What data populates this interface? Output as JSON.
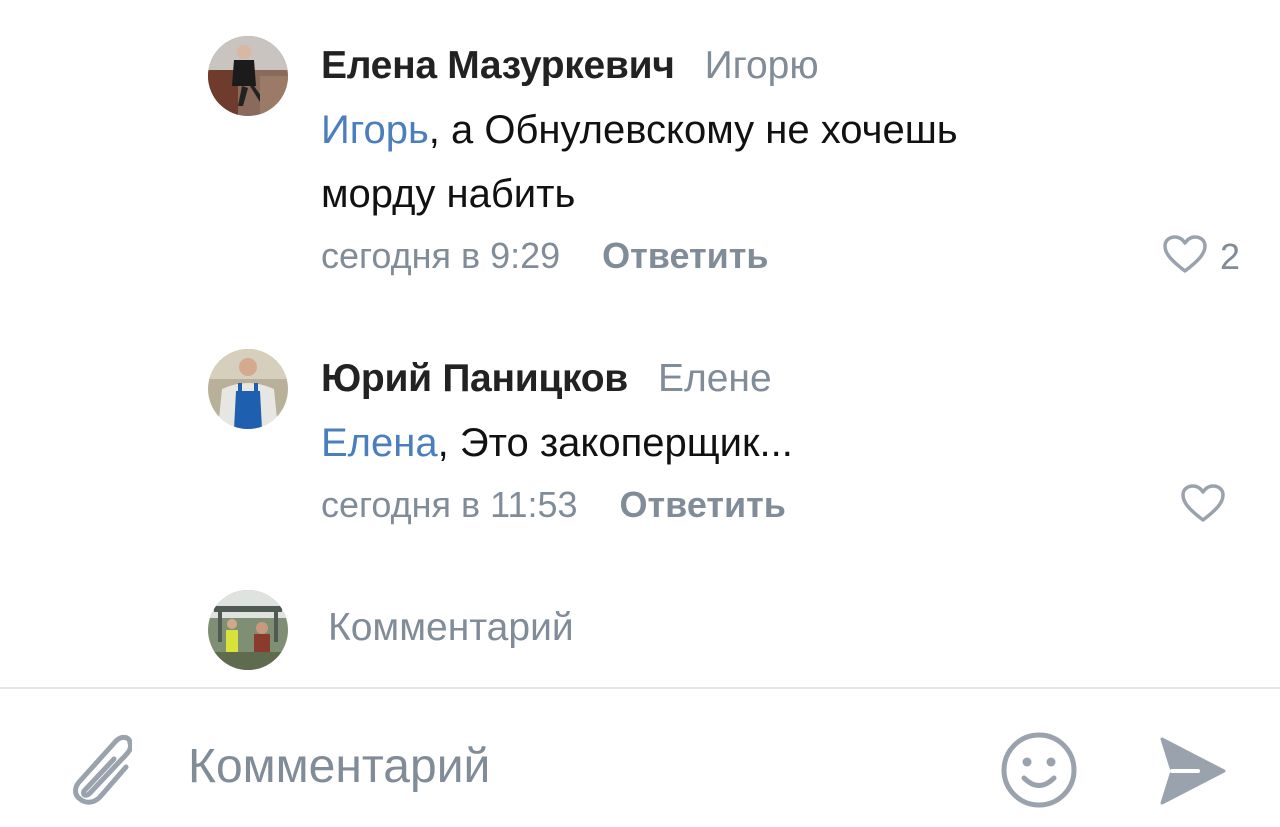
{
  "comments": [
    {
      "author": "Елена Мазуркевич",
      "reply_to": "Игорю",
      "mention": "Игорь",
      "text_line1_rest": ", а Обнулевскому не хочешь",
      "text_line2": "морду набить",
      "time": "сегодня в 9:29",
      "reply_label": "Ответить",
      "likes": "2"
    },
    {
      "author": "Юрий Паницков",
      "reply_to": "Елене",
      "mention": "Елена",
      "text_line1_rest": ", Это закоперщик...",
      "time": "сегодня в 11:53",
      "reply_label": "Ответить"
    }
  ],
  "reply_row": {
    "placeholder": "Комментарий"
  },
  "composer": {
    "placeholder": "Комментарий"
  },
  "icons": {
    "like": "heart-outline-icon",
    "attach": "paperclip-icon",
    "emoji": "smiley-icon",
    "send": "send-arrow-icon"
  },
  "colors": {
    "accent_link": "#4a7ebd",
    "secondary_text": "#818c99",
    "icon_gray": "#99a2ad",
    "author_text": "#222222",
    "divider": "#e3e5e8"
  }
}
